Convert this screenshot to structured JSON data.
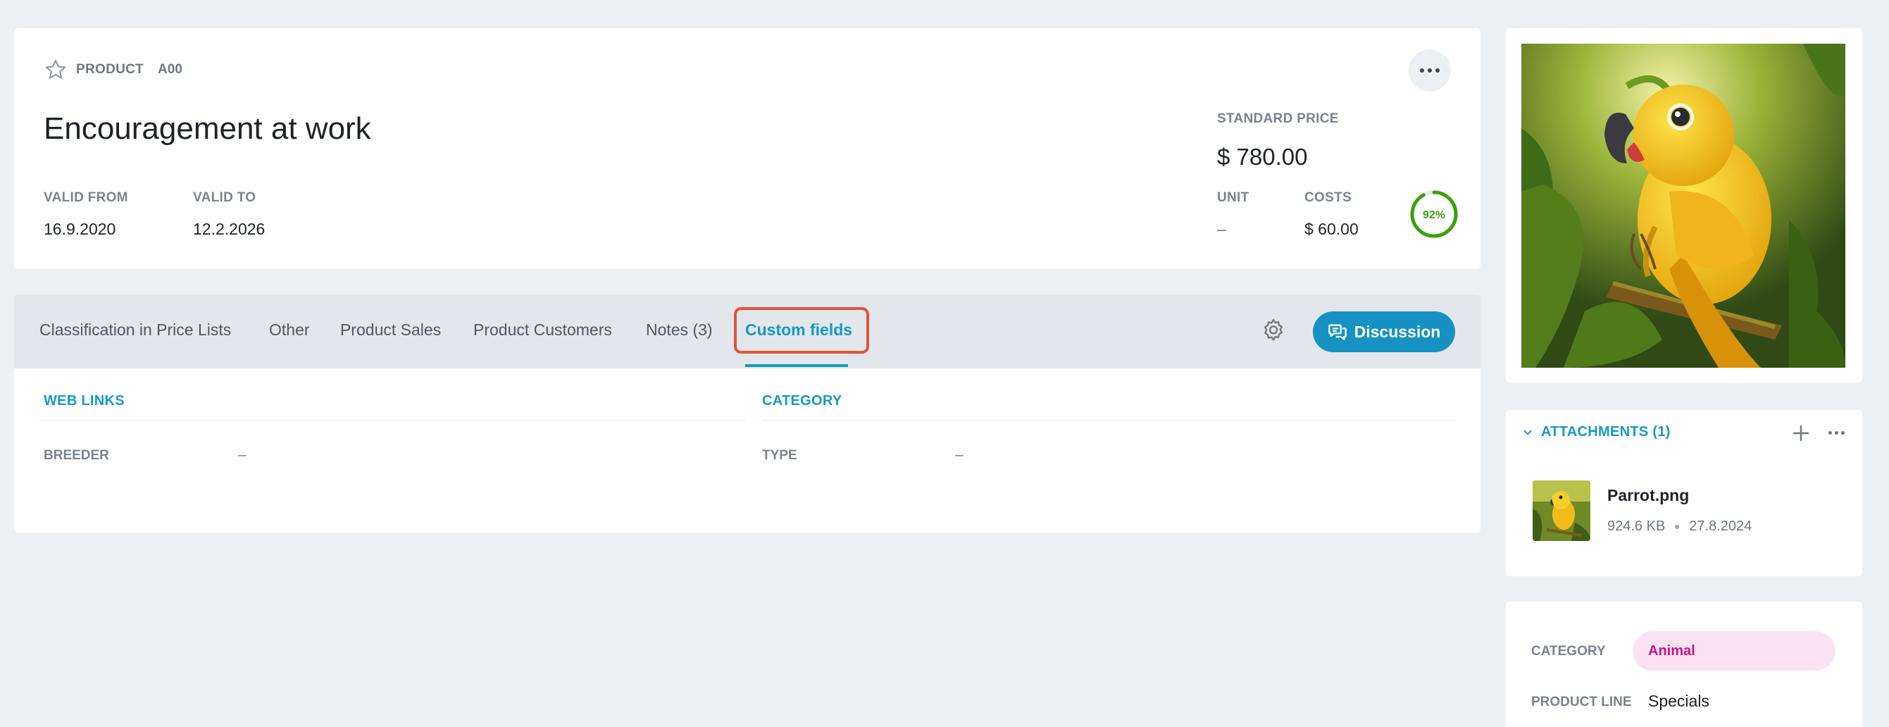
{
  "header": {
    "type_label": "PRODUCT",
    "code": "A00",
    "title": "Encouragement at work",
    "valid_from_label": "VALID FROM",
    "valid_from": "16.9.2020",
    "valid_to_label": "VALID TO",
    "valid_to": "12.2.2026",
    "standard_price_label": "STANDARD PRICE",
    "standard_price": "$ 780.00",
    "unit_label": "UNIT",
    "unit": "–",
    "costs_label": "COSTS",
    "costs": "$ 60.00",
    "margin_percent_text": "92%",
    "margin_fraction": 0.92,
    "progress_color": "#3aa10a"
  },
  "tabs": {
    "items": [
      "Classification in Price Lists",
      "Other",
      "Product Sales",
      "Product Customers",
      "Notes (3)",
      "Custom fields"
    ],
    "active_index": 5,
    "settings_icon": "gear-icon",
    "discussion_label": "Discussion",
    "accent_color": "#1699c4"
  },
  "custom_fields": {
    "left_section": "WEB LINKS",
    "left_field_label": "BREEDER",
    "left_field_value": "–",
    "right_section": "CATEGORY",
    "right_field_label": "TYPE",
    "right_field_value": "–"
  },
  "attachments": {
    "title": "ATTACHMENTS (1)",
    "file_name": "Parrot.png",
    "file_size": "924.6 KB",
    "file_date": "27.8.2024"
  },
  "classification": {
    "category_label": "CATEGORY",
    "category_value": "Animal",
    "product_line_label": "PRODUCT LINE",
    "product_line_value": "Specials"
  }
}
